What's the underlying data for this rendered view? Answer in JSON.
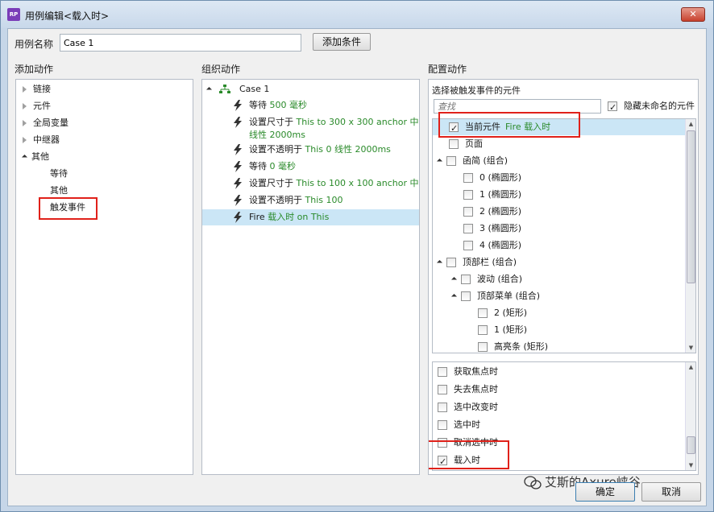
{
  "window": {
    "title": "用例编辑<载入时>",
    "app_icon": "RP",
    "close_glyph": "✕"
  },
  "case": {
    "label": "用例名称",
    "value": "Case 1",
    "add_condition": "添加条件"
  },
  "sections": {
    "add_action": "添加动作",
    "organize_action": "组织动作",
    "configure_action": "配置动作"
  },
  "add_tree": {
    "items": [
      "链接",
      "元件",
      "全局变量",
      "中继器",
      "其他"
    ],
    "sub_items": [
      "等待",
      "其他",
      "触发事件"
    ]
  },
  "organize": {
    "case_name": "Case 1",
    "actions": [
      {
        "prefix": "等待 ",
        "detail": "500 毫秒",
        "detail2": ""
      },
      {
        "prefix": "设置尺寸于 ",
        "detail": "This to 300 x 300 anchor 中心",
        "detail2": "线性 2000ms"
      },
      {
        "prefix": "设置不透明于 ",
        "detail": "This 0 线性 2000ms",
        "detail2": ""
      },
      {
        "prefix": "等待 ",
        "detail": "0 毫秒",
        "detail2": ""
      },
      {
        "prefix": "设置尺寸于 ",
        "detail": "This to 100 x 100 anchor 中心",
        "detail2": ""
      },
      {
        "prefix": "设置不透明于 ",
        "detail": "This 100",
        "detail2": ""
      },
      {
        "prefix": "Fire ",
        "detail": "载入时 on This",
        "detail2": ""
      }
    ]
  },
  "configure": {
    "select_label": "选择被触发事件的元件",
    "search_placeholder": "查找",
    "hide_unnamed": "隐藏未命名的元件",
    "elements": [
      {
        "label": "当前元件",
        "extra": "Fire 载入时",
        "checked": true,
        "tri": "",
        "indent": 0
      },
      {
        "label": "页面",
        "extra": "",
        "checked": false,
        "tri": "",
        "indent": 0
      },
      {
        "label": "函简 (组合)",
        "extra": "",
        "checked": false,
        "tri": "open",
        "indent": 0
      },
      {
        "label": "0 (椭圆形)",
        "extra": "",
        "checked": false,
        "tri": "",
        "indent": 1
      },
      {
        "label": "1 (椭圆形)",
        "extra": "",
        "checked": false,
        "tri": "",
        "indent": 1
      },
      {
        "label": "2 (椭圆形)",
        "extra": "",
        "checked": false,
        "tri": "",
        "indent": 1
      },
      {
        "label": "3 (椭圆形)",
        "extra": "",
        "checked": false,
        "tri": "",
        "indent": 1
      },
      {
        "label": "4 (椭圆形)",
        "extra": "",
        "checked": false,
        "tri": "",
        "indent": 1
      },
      {
        "label": "顶部栏 (组合)",
        "extra": "",
        "checked": false,
        "tri": "open",
        "indent": 0
      },
      {
        "label": "波动 (组合)",
        "extra": "",
        "checked": false,
        "tri": "dark",
        "indent": 1
      },
      {
        "label": "顶部菜单 (组合)",
        "extra": "",
        "checked": false,
        "tri": "dark",
        "indent": 1
      },
      {
        "label": "2 (矩形)",
        "extra": "",
        "checked": false,
        "tri": "",
        "indent": 2
      },
      {
        "label": "1 (矩形)",
        "extra": "",
        "checked": false,
        "tri": "",
        "indent": 2
      },
      {
        "label": "高亮条 (矩形)",
        "extra": "",
        "checked": false,
        "tri": "",
        "indent": 2
      }
    ],
    "events": [
      {
        "label": "获取焦点时",
        "checked": false
      },
      {
        "label": "失去焦点时",
        "checked": false
      },
      {
        "label": "选中改变时",
        "checked": false
      },
      {
        "label": "选中时",
        "checked": false
      },
      {
        "label": "取消选中时",
        "checked": false
      },
      {
        "label": "载入时",
        "checked": true
      }
    ]
  },
  "footer": {
    "ok": "确定",
    "cancel": "取消",
    "watermark": "艾斯的Axure峡谷"
  },
  "colors": {
    "accent_green": "#2a8a2a",
    "highlight": "#cbe6f6",
    "annotation_red": "#e0211a"
  }
}
